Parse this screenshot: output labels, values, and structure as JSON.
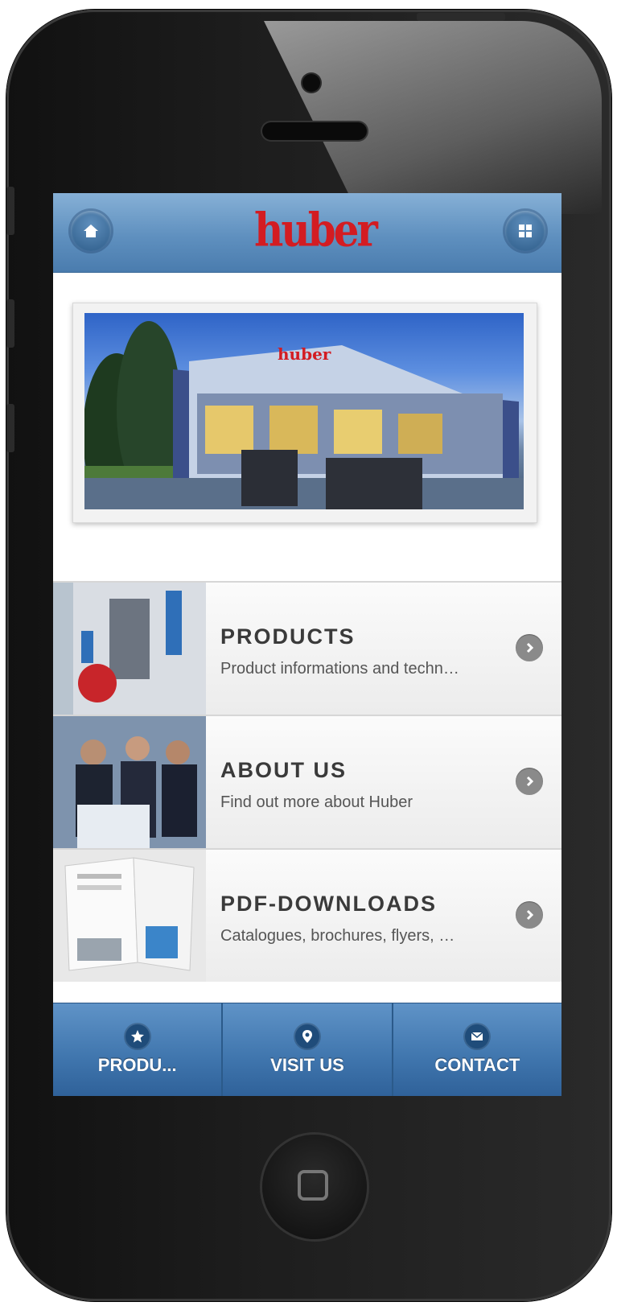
{
  "header": {
    "logo_text": "huber",
    "home_icon": "home-icon",
    "grid_icon": "grid-icon",
    "brand_color": "#d31c22"
  },
  "menu": {
    "items": [
      {
        "title": "PRODUCTS",
        "description": "Product informations and techn…"
      },
      {
        "title": "ABOUT US",
        "description": "Find out more about Huber"
      },
      {
        "title": "PDF-DOWNLOADS",
        "description": "Catalogues, brochures, flyers, …"
      }
    ]
  },
  "tabbar": {
    "tabs": [
      {
        "label": "PRODU...",
        "icon": "star-icon"
      },
      {
        "label": "VISIT US",
        "icon": "location-pin-icon"
      },
      {
        "label": "CONTACT",
        "icon": "mail-icon"
      }
    ]
  }
}
